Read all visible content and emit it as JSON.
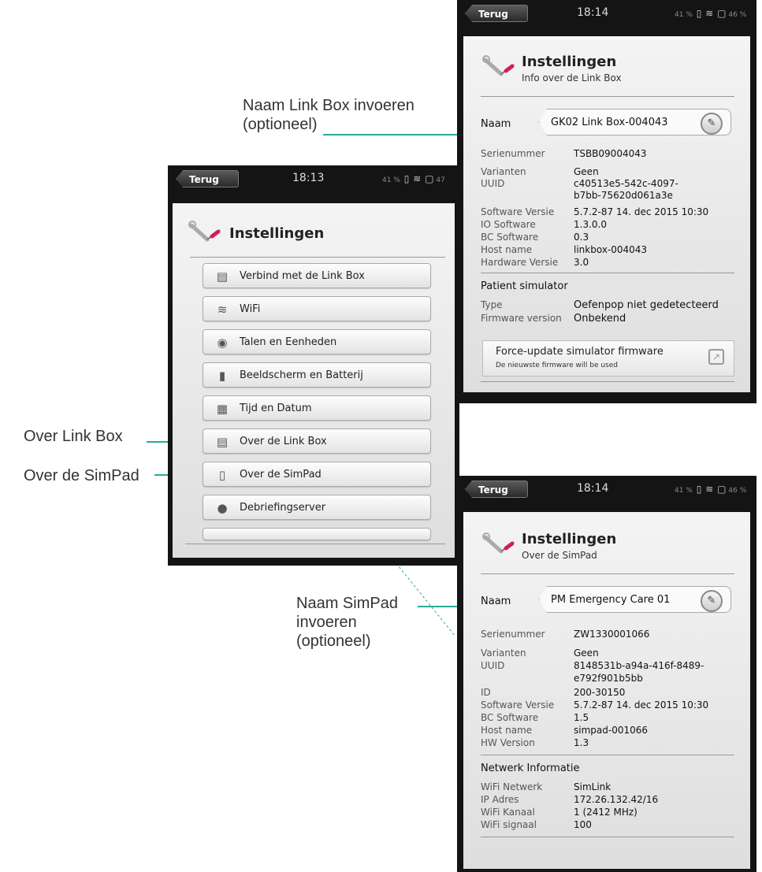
{
  "common": {
    "back_label": "Terug"
  },
  "left_screen": {
    "time": "18:13",
    "status_battery": "41 %",
    "status_right": "47",
    "title": "Instellingen",
    "menu": [
      {
        "icon": "link-box-icon",
        "label": "Verbind met de Link Box"
      },
      {
        "icon": "wifi-icon",
        "label": "WiFi"
      },
      {
        "icon": "globe-icon",
        "label": "Talen en Eenheden"
      },
      {
        "icon": "display-battery-icon",
        "label": "Beeldscherm en Batterij"
      },
      {
        "icon": "calendar-clock-icon",
        "label": "Tijd en Datum"
      },
      {
        "icon": "link-box-info-icon",
        "label": "Over de Link Box"
      },
      {
        "icon": "simpad-info-icon",
        "label": "Over de SimPad"
      },
      {
        "icon": "camera-icon",
        "label": "Debriefingserver"
      }
    ]
  },
  "linkbox_screen": {
    "time": "18:14",
    "status_battery": "41 %",
    "status_right": "46 %",
    "title": "Instellingen",
    "subtitle": "Info over de Link Box",
    "name_label": "Naam",
    "name_value": "GK02 Link Box-004043",
    "rows": [
      {
        "label": "Serienummer",
        "value": "TSBB09004043"
      },
      {
        "label": "Varianten",
        "value": "Geen"
      },
      {
        "label": "UUID",
        "value": "c40513e5-542c-4097-"
      },
      {
        "label": "",
        "value": "b7bb-75620d061a3e"
      },
      {
        "label": "Software Versie",
        "value": "5.7.2-87 14. dec 2015 10:30"
      },
      {
        "label": "IO Software",
        "value": "1.3.0.0"
      },
      {
        "label": "BC Software",
        "value": "0.3"
      },
      {
        "label": "Host name",
        "value": "linkbox-004043"
      },
      {
        "label": "Hardware Versie",
        "value": "3.0"
      }
    ],
    "patient_section": "Patient simulator",
    "patient_rows": [
      {
        "label": "Type",
        "value": "Oefenpop niet gedetecteerd"
      },
      {
        "label": "Firmware version",
        "value": "Onbekend"
      }
    ],
    "force_update_title": "Force-update simulator firmware",
    "force_update_sub": "De nieuwste firmware will be used"
  },
  "simpad_screen": {
    "time": "18:14",
    "status_battery": "41 %",
    "status_right": "46 %",
    "title": "Instellingen",
    "subtitle": "Over de SimPad",
    "name_label": "Naam",
    "name_value": "PM Emergency Care 01",
    "rows": [
      {
        "label": "Serienummer",
        "value": "ZW1330001066"
      },
      {
        "label": "Varianten",
        "value": "Geen"
      },
      {
        "label": "UUID",
        "value": "8148531b-a94a-416f-8489-"
      },
      {
        "label": "",
        "value": "e792f901b5bb"
      },
      {
        "label": "ID",
        "value": "200-30150"
      },
      {
        "label": "Software Versie",
        "value": "5.7.2-87 14. dec 2015 10:30"
      },
      {
        "label": "BC Software",
        "value": "1.5"
      },
      {
        "label": "Host name",
        "value": "simpad-001066"
      },
      {
        "label": "HW Version",
        "value": "1.3"
      }
    ],
    "network_section": "Netwerk Informatie",
    "network_rows": [
      {
        "label": "WiFi Netwerk",
        "value": "SimLink"
      },
      {
        "label": "IP Adres",
        "value": "172.26.132.42/16"
      },
      {
        "label": "WiFi Kanaal",
        "value": "1 (2412 MHz)"
      },
      {
        "label": "WiFi signaal",
        "value": "100"
      }
    ]
  },
  "callouts": {
    "linkbox_name_line1": "Naam Link Box invoeren",
    "linkbox_name_line2": "(optioneel)",
    "over_linkbox": "Over Link Box",
    "over_simpad": "Over de SimPad",
    "simpad_name_line1": "Naam SimPad",
    "simpad_name_line2": "invoeren",
    "simpad_name_line3": "(optioneel)"
  },
  "colors": {
    "callout_line": "#2aa99a",
    "dotted_line": "#2aa99a"
  }
}
